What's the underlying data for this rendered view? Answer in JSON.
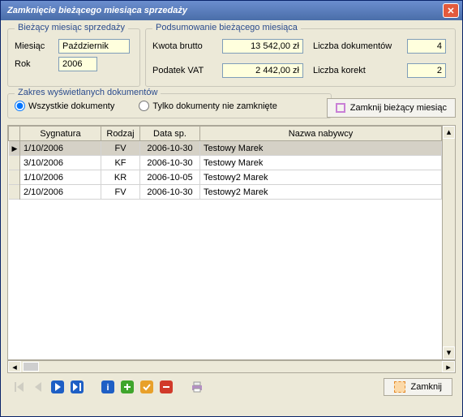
{
  "window": {
    "title": "Zamknięcie bieżącego miesiąca sprzedaży"
  },
  "month_box": {
    "legend": "Bieżący miesiąc sprzedaży",
    "month_label": "Miesiąc",
    "month_value": "Październik",
    "year_label": "Rok",
    "year_value": "2006"
  },
  "summary_box": {
    "legend": "Podsumowanie bieżącego miesiąca",
    "gross_label": "Kwota brutto",
    "gross_value": "13 542,00 zł",
    "vat_label": "Podatek VAT",
    "vat_value": "2 442,00 zł",
    "docs_label": "Liczba dokumentów",
    "docs_value": "4",
    "corr_label": "Liczba korekt",
    "corr_value": "2"
  },
  "scope_box": {
    "legend": "Zakres wyświetlanych dokumentów",
    "opt_all": "Wszystkie dokumenty",
    "opt_open": "Tylko dokumenty nie zamknięte"
  },
  "close_month_btn": "Zamknij bieżący miesiąc",
  "table": {
    "headers": {
      "sig": "Sygnatura",
      "kind": "Rodzaj",
      "date": "Data sp.",
      "buyer": "Nazwa nabywcy"
    },
    "rows": [
      {
        "sig": "1/10/2006",
        "kind": "FV",
        "date": "2006-10-30",
        "buyer": "Testowy Marek",
        "selected": true
      },
      {
        "sig": "3/10/2006",
        "kind": "KF",
        "date": "2006-10-30",
        "buyer": "Testowy Marek",
        "selected": false
      },
      {
        "sig": "1/10/2006",
        "kind": "KR",
        "date": "2006-10-05",
        "buyer": "Testowy2 Marek",
        "selected": false
      },
      {
        "sig": "2/10/2006",
        "kind": "FV",
        "date": "2006-10-30",
        "buyer": "Testowy2 Marek",
        "selected": false
      }
    ]
  },
  "footer": {
    "close": "Zamknij"
  },
  "icons": {
    "first": "first-icon",
    "prev": "prev-icon",
    "next": "next-icon",
    "last": "last-icon",
    "info": "info-icon",
    "add": "add-icon",
    "edit": "edit-icon",
    "delete": "delete-icon",
    "print": "print-icon"
  }
}
